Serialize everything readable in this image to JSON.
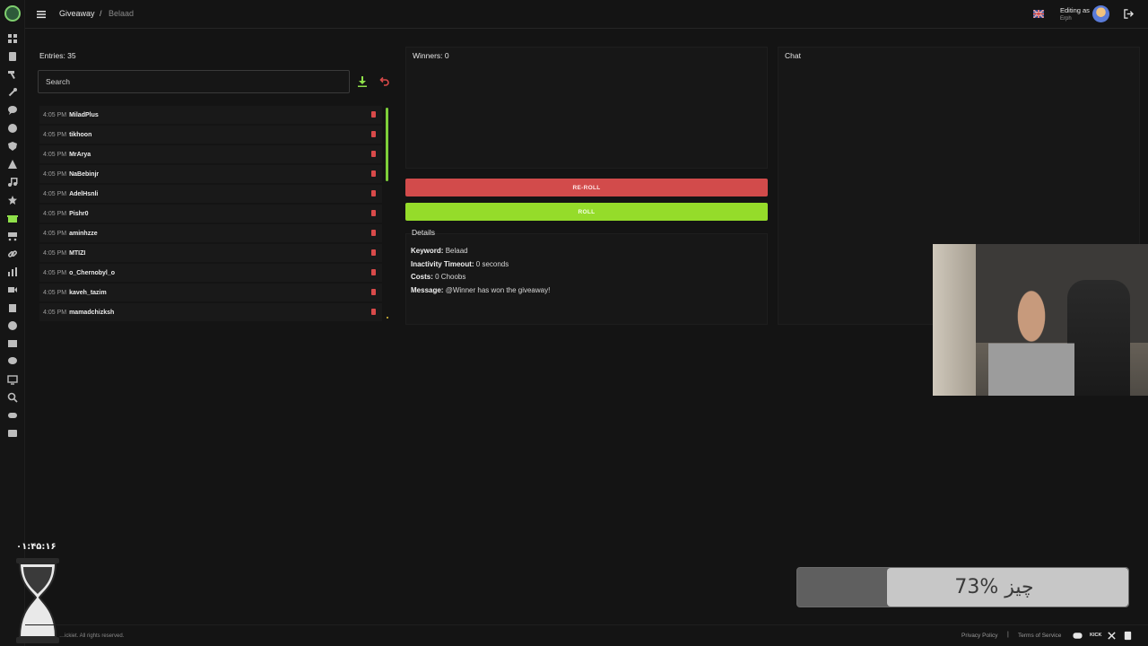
{
  "header": {
    "breadcrumb_main": "Giveaway",
    "breadcrumb_separator": "/",
    "breadcrumb_sub": "Belaad",
    "editing_label": "Editing as",
    "editing_user": "Erph"
  },
  "entries": {
    "title": "Entries: 35",
    "search_placeholder": "Search",
    "items": [
      {
        "time": "4:05 PM",
        "name": "MiladPlus"
      },
      {
        "time": "4:05 PM",
        "name": "tikhoon"
      },
      {
        "time": "4:05 PM",
        "name": "MrArya"
      },
      {
        "time": "4:05 PM",
        "name": "NaBebinjr"
      },
      {
        "time": "4:05 PM",
        "name": "AdelHsnli"
      },
      {
        "time": "4:05 PM",
        "name": "Pishr0"
      },
      {
        "time": "4:05 PM",
        "name": "aminhzze"
      },
      {
        "time": "4:05 PM",
        "name": "MTIZI"
      },
      {
        "time": "4:05 PM",
        "name": "o_Chernobyl_o"
      },
      {
        "time": "4:05 PM",
        "name": "kaveh_tazim"
      },
      {
        "time": "4:05 PM",
        "name": "mamadchizksh"
      }
    ]
  },
  "winners": {
    "title": "Winners: 0"
  },
  "controls": {
    "reroll_label": "RE-ROLL",
    "roll_label": "ROLL"
  },
  "details": {
    "title": "Details",
    "keyword_label": "Keyword:",
    "keyword_value": "Belaad",
    "inactivity_label": "Inactivity Timeout:",
    "inactivity_value": "0 seconds",
    "costs_label": "Costs:",
    "costs_value": "0 Choobs",
    "message_label": "Message:",
    "message_value": "@Winner has won the giveaway!"
  },
  "chat": {
    "title": "Chat"
  },
  "overlay": {
    "timer": "۰۱:۴۵:۱۶",
    "progress_label": "73% چیز",
    "progress_fraction": 0.73
  },
  "footer": {
    "copyright": "…ickiet. All rights reserved.",
    "privacy": "Privacy Policy",
    "separator": "|",
    "terms": "Terms of Service",
    "kick": "KICK"
  },
  "colors": {
    "accent_green": "#95dc2a",
    "danger_red": "#d24b4b",
    "background": "#141414"
  },
  "sidebar_icons": [
    "dashboard-icon",
    "document-icon",
    "hammer-icon",
    "wrench-icon",
    "chat-bubble-icon",
    "clock-icon",
    "shield-icon",
    "warning-icon",
    "music-icon",
    "star-icon",
    "gift-icon",
    "cart-icon",
    "link-icon",
    "chart-icon",
    "video-icon",
    "clipboard-icon",
    "smile-icon",
    "film-icon",
    "comment-icon",
    "monitor-icon",
    "search-icon",
    "discord-icon",
    "list-icon"
  ]
}
